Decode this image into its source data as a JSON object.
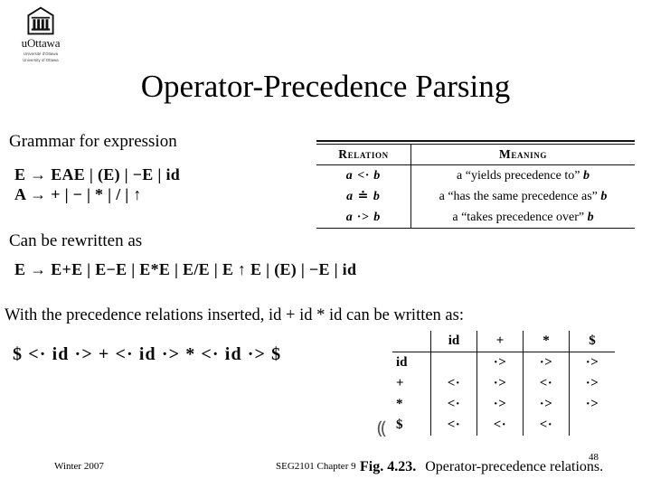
{
  "logo": {
    "wordmark": "uOttawa",
    "tagline_line1": "Université d'Ottawa",
    "tagline_line2": "University of Ottawa",
    "crest_name": "uottawa-crest-icon"
  },
  "title": "Operator-Precedence Parsing",
  "body": {
    "grammar_label": "Grammar for expression",
    "rewritten_label": "Can be rewritten as",
    "inserted_label": "With the precedence relations inserted, id + id * id can be written as:"
  },
  "grammar": {
    "production_E": "E → EAE | (E) | −E | id",
    "production_A": "A → + | − | * | / | ↑",
    "production_rewritten": "E → E+E | E−E | E*E | E/E | E ↑ E | (E) | −E | id"
  },
  "sentential_form": "$ <· id ·> + <· id ·> * <· id ·> $",
  "relation_table": {
    "headers": [
      "Relation",
      "Meaning"
    ],
    "rows": [
      {
        "relation": "a <· b",
        "meaning_pre": "a “yields precedence to” ",
        "meaning_var": "b"
      },
      {
        "relation": "a ≐ b",
        "meaning_pre": "a “has the same precedence as” ",
        "meaning_var": "b"
      },
      {
        "relation": "a ·> b",
        "meaning_pre": "a “takes precedence over” ",
        "meaning_var": "b"
      }
    ]
  },
  "precedence_matrix": {
    "corner": "",
    "col_headers": [
      "id",
      "+",
      "*",
      "$"
    ],
    "row_headers": [
      "id",
      "+",
      "*",
      "$"
    ],
    "cells": [
      [
        "",
        "·>",
        "·>",
        "·>"
      ],
      [
        "<·",
        "·>",
        "<·",
        "·>"
      ],
      [
        "<·",
        "·>",
        "·>",
        "·>"
      ],
      [
        "<·",
        "<·",
        "<·",
        ""
      ]
    ]
  },
  "figure_caption": {
    "number": "Fig. 4.23.",
    "text": "Operator-precedence relations."
  },
  "footer": {
    "left": "Winter 2007",
    "center": "SEG2101 Chapter 9",
    "page": "48"
  },
  "artifact": "⸨"
}
